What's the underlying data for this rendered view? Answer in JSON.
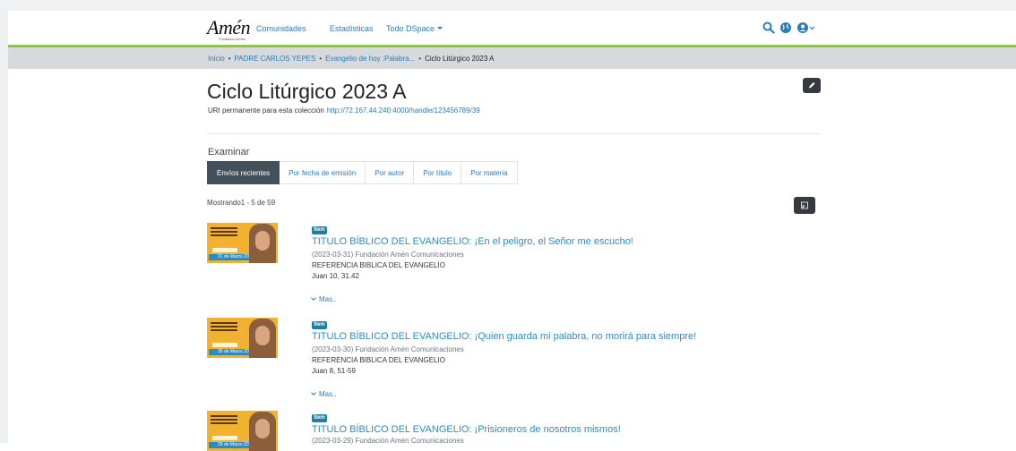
{
  "logo": {
    "main": "Amén",
    "sub": "Fundación Amén"
  },
  "nav": {
    "communities": "Comunidades",
    "statistics": "Estadísticas",
    "all_dspace": "Todo DSpace"
  },
  "breadcrumb": {
    "items": [
      "Inicio",
      "PADRE CARLOS YEPES",
      "Evangelio de hoy :Palabra...",
      "Ciclo Litúrgico 2023 A"
    ]
  },
  "collection": {
    "title": "Ciclo Litúrgico 2023 A",
    "uri_label": "URI permanente para esta colección",
    "uri": "http://72.167.44.240:4000/handle/123456789/39"
  },
  "browse": {
    "heading": "Examinar",
    "tabs": [
      "Envíos recientes",
      "Por fecha de emisión",
      "Por autor",
      "Por título",
      "Por materia"
    ],
    "active_tab": "Envíos recientes"
  },
  "results": {
    "showing": "Mostrando1 - 5 de 59"
  },
  "items": [
    {
      "badge": "Ítem",
      "title": "TITULO BÍBLICO DEL EVANGELIO: ¡En el peligro, el Señor me escucho!",
      "meta": "(2023-03-31) Fundación Amén Comunicaciones",
      "ref_label": "REFERENCIA BIBLICA DEL EVANGELIO",
      "ref": "Juan 10, 31.42",
      "more": "Mas..",
      "thumb_date": "31 de Marzo 2023"
    },
    {
      "badge": "Ítem",
      "title": "TITULO BÍBLICO DEL EVANGELIO: ¡Quien guarda mi palabra, no morirá para siempre!",
      "meta": "(2023-03-30) Fundación Amén Comunicaciones",
      "ref_label": "REFERENCIA BIBLICA DEL EVANGELIO",
      "ref": "Juan 8, 51-59",
      "more": "Mas..",
      "thumb_date": "30 de Marzo 2023"
    },
    {
      "badge": "Ítem",
      "title": "TITULO BÍBLICO DEL EVANGELIO: ¡Prisioneros de nosotros mismos!",
      "meta": "(2023-03-29) Fundación Amén Comunicaciones",
      "thumb_date": "29 de Marzo 2023"
    }
  ]
}
